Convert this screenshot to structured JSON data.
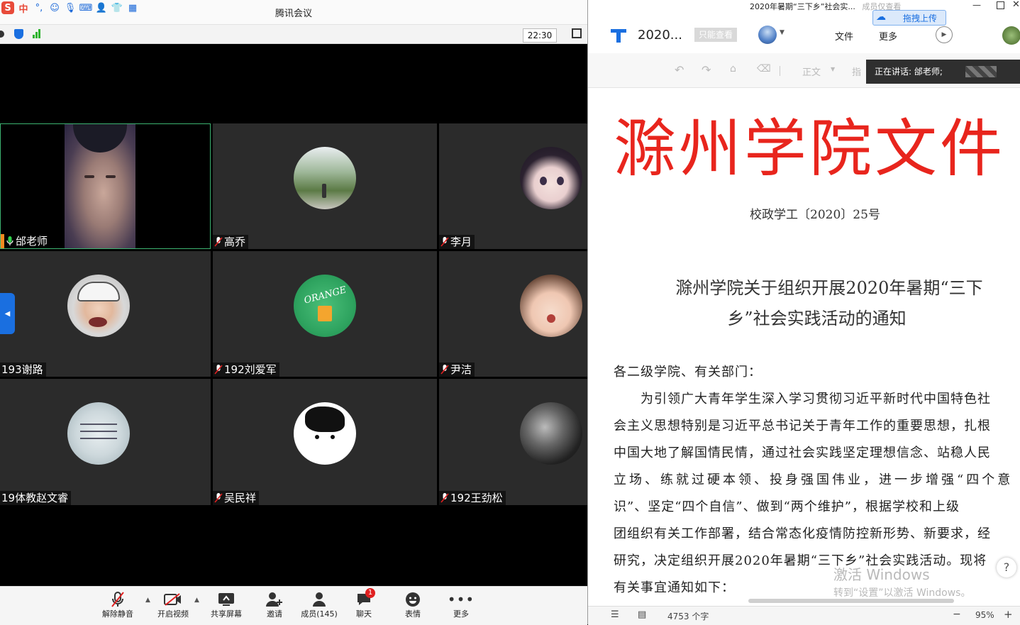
{
  "meeting": {
    "title": "腾讯会议",
    "ime_label": "中",
    "clock": "22:30",
    "participants": [
      {
        "name": "邰老师",
        "muted": false,
        "video": true
      },
      {
        "name": "高乔",
        "muted": true
      },
      {
        "name": "李月",
        "muted": true
      },
      {
        "name": "193谢路",
        "muted": false
      },
      {
        "name": "192刘爱军",
        "muted": true
      },
      {
        "name": "尹洁",
        "muted": true
      },
      {
        "name": "19体教赵文睿",
        "muted": false
      },
      {
        "name": "吴民祥",
        "muted": true
      },
      {
        "name": "192王劲松",
        "muted": true
      }
    ],
    "toolbar": {
      "unmute": "解除静音",
      "video": "开启视频",
      "share": "共享屏幕",
      "invite": "邀请",
      "members": "成员(145)",
      "chat": "聊天",
      "chat_badge": "1",
      "emoji": "表情",
      "more": "更多"
    }
  },
  "doc": {
    "window_title": "2020年暑期“三下乡”社会实...",
    "window_title_suffix": "成员仅查看",
    "upload_btn": "拖拽上传",
    "doc_name": "2020...",
    "readonly_badge": "只能查看",
    "menu_file": "文件",
    "menu_more": "更多",
    "toolbar_style": "正文",
    "toolbar_cut": "指",
    "speaking": "正在讲话: 邰老师;",
    "header_title": "滁州学院文件",
    "doc_number": "校政学工〔2020〕25号",
    "notice_title_line1": "滁州学院关于组织开展2020年暑期“三下",
    "notice_title_line2": "乡”社会实践活动的通知",
    "salutation": "各二级学院、有关部门：",
    "body_lines": [
      "为引领广大青年学生深入学习贯彻习近平新时代中国特色社",
      "会主义思想特别是习近平总书记关于青年工作的重要思想，扎根",
      "中国大地了解国情民情，通过社会实践坚定理想信念、站稳人民",
      "立场、练就过硬本领、投身强国伟业，进一步增强“四个意",
      "识”、坚定“四个自信”、做到“两个维护”，根据学校和上级",
      "团组织有关工作部署，结合常态化疫情防控新形势、新要求，经",
      "研究，决定组织开展2020年暑期“三下乡”社会实践活动。现将",
      "有关事宜通知如下："
    ],
    "word_count": "4753 个字",
    "zoom": "95%",
    "watermark_line1": "激活 Windows",
    "watermark_line2": "转到“设置”以激活 Windows。",
    "help": "?"
  },
  "colors": {
    "header_red": "#e8251d",
    "active_speaker_border": "#3cb371",
    "accent_blue": "#1a6fe0"
  }
}
